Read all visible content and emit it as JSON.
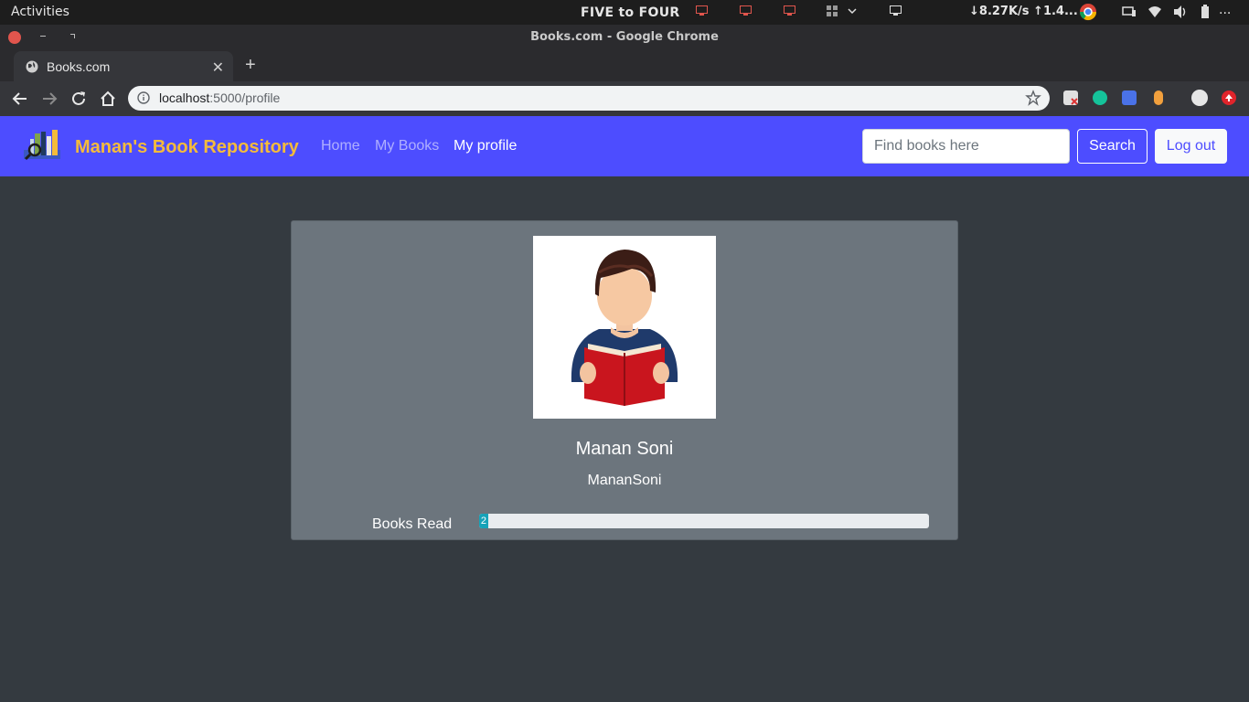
{
  "os": {
    "activities": "Activities",
    "clock": "FIVE to FOUR",
    "net_speed": "↓8.27K/s ↑1.4...",
    "overflow": "..."
  },
  "browser": {
    "window_title": "Books.com - Google Chrome",
    "tab_title": "Books.com",
    "url_host": "localhost",
    "url_rest": ":5000/profile"
  },
  "navbar": {
    "brand": "Manan's Book Repository",
    "links": [
      {
        "label": "Home",
        "active": false
      },
      {
        "label": "My Books",
        "active": false
      },
      {
        "label": "My profile",
        "active": true
      }
    ],
    "search_placeholder": "Find books here",
    "search_label": "Search",
    "logout_label": "Log out"
  },
  "profile": {
    "name": "Manan Soni",
    "username": "MananSoni",
    "books_read_label": "Books Read",
    "books_read_value": "2",
    "books_read_percent": 2
  },
  "colors": {
    "navbar": "#4d4dff",
    "brand": "#f4bb3b",
    "card": "#6c757d",
    "page_bg": "#343a40",
    "progress": "#17a2b8"
  }
}
